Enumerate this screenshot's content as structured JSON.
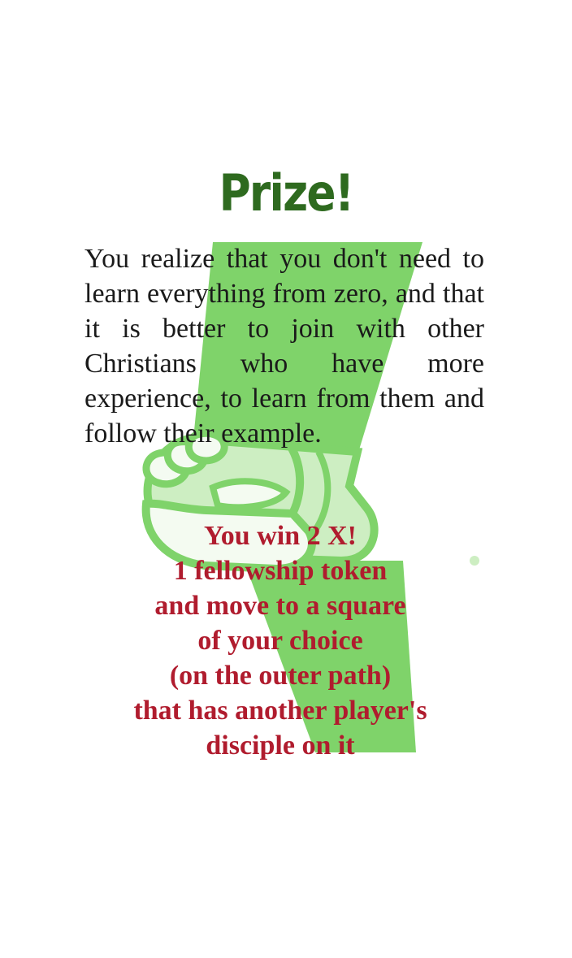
{
  "card": {
    "title": "Prize!",
    "story": "You realize that you don't need to learn everything from zero, and that it is better to join with other Christians who have more experience, to learn from them and follow their example.",
    "prize_lines": [
      "You win 2 X!",
      "1 fellowship token",
      "and move to a square",
      "of your choice",
      "(on the outer path)",
      "that has another player's",
      "disciple on it"
    ],
    "art_icon": "clasped-hands-icon"
  },
  "colors": {
    "title": "#2e6a1f",
    "prize_text": "#b01c2e",
    "story_text": "#1a1a1a",
    "art_green": "#7fd36a",
    "art_light": "#cdeec2",
    "art_white": "#f4fbf1"
  }
}
